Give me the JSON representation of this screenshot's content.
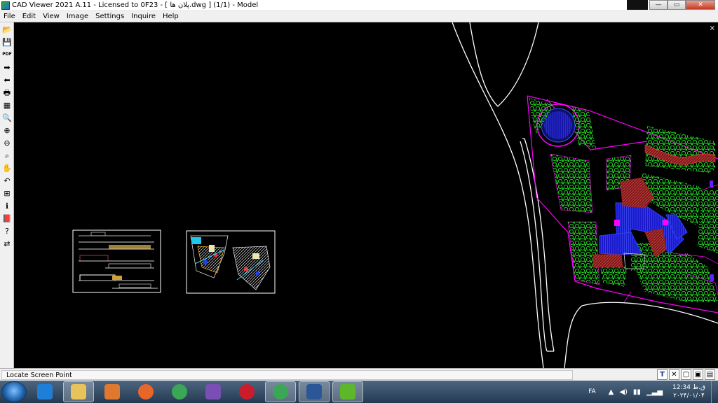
{
  "window": {
    "title": "CAD Viewer 2021 A.11 - Licensed to 0F23  -  [ پلان ها.dwg ] (1/1)  -  Model",
    "controls": {
      "minimize": "—",
      "maximize": "▭",
      "close": "✕"
    }
  },
  "menu": [
    "File",
    "Edit",
    "View",
    "Image",
    "Settings",
    "Inquire",
    "Help"
  ],
  "toolbar": [
    {
      "icon": "open-folder-icon",
      "glyph": "📂"
    },
    {
      "icon": "save-icon",
      "glyph": "💾"
    },
    {
      "icon": "pdf-icon",
      "glyph": "PDF"
    },
    {
      "icon": "arrow-right-icon",
      "glyph": "➡"
    },
    {
      "icon": "arrow-left-icon",
      "glyph": "⬅"
    },
    {
      "icon": "print-icon",
      "glyph": "🖶"
    },
    {
      "icon": "layers-icon",
      "glyph": "▦"
    },
    {
      "icon": "zoom-icon",
      "glyph": "🔍"
    },
    {
      "icon": "zoom-in-icon",
      "glyph": "⊕"
    },
    {
      "icon": "zoom-out-icon",
      "glyph": "⊖"
    },
    {
      "icon": "zoom-window-icon",
      "glyph": "⌕"
    },
    {
      "icon": "pan-hand-icon",
      "glyph": "✋"
    },
    {
      "icon": "undo-icon",
      "glyph": "↶"
    },
    {
      "icon": "measure-icon",
      "glyph": "⊞"
    },
    {
      "icon": "info-icon",
      "glyph": "ℹ"
    },
    {
      "icon": "book-icon",
      "glyph": "📕"
    },
    {
      "icon": "help-icon",
      "glyph": "?"
    },
    {
      "icon": "export-icon",
      "glyph": "⇄"
    }
  ],
  "canvas": {
    "close_glyph": "×",
    "background": "#000000"
  },
  "status": {
    "text": "Locate Screen Point",
    "buttons": [
      "T",
      "✕",
      "▢",
      "▣",
      "▤"
    ]
  },
  "taskbar": {
    "apps": [
      {
        "name": "internet-explorer",
        "color": "#1e7fd8"
      },
      {
        "name": "file-explorer",
        "color": "#e8c25a",
        "active": true
      },
      {
        "name": "media-player",
        "color": "#e07830"
      },
      {
        "name": "firefox",
        "color": "#e8662a"
      },
      {
        "name": "chrome",
        "color": "#3aa757"
      },
      {
        "name": "visual-studio",
        "color": "#7a4fb5"
      },
      {
        "name": "opera",
        "color": "#cc1c2c"
      },
      {
        "name": "chrome-profile",
        "color": "#3aa757",
        "active": true
      },
      {
        "name": "word",
        "color": "#2b5797",
        "active": true
      },
      {
        "name": "cad-viewer",
        "color": "#5cb82a",
        "active": true
      }
    ],
    "tray": {
      "language": "FA",
      "time": "12:34 ق.ظ",
      "date": "۲۰۲۴/۰۱/۰۴"
    }
  },
  "colors": {
    "road": "#ffffff",
    "boundary": "#ff00ff",
    "trees": "#22cc22",
    "building_blue": "#1a1acc",
    "building_red": "#8b2020",
    "hatch_dark_blue": "#2030a0"
  }
}
